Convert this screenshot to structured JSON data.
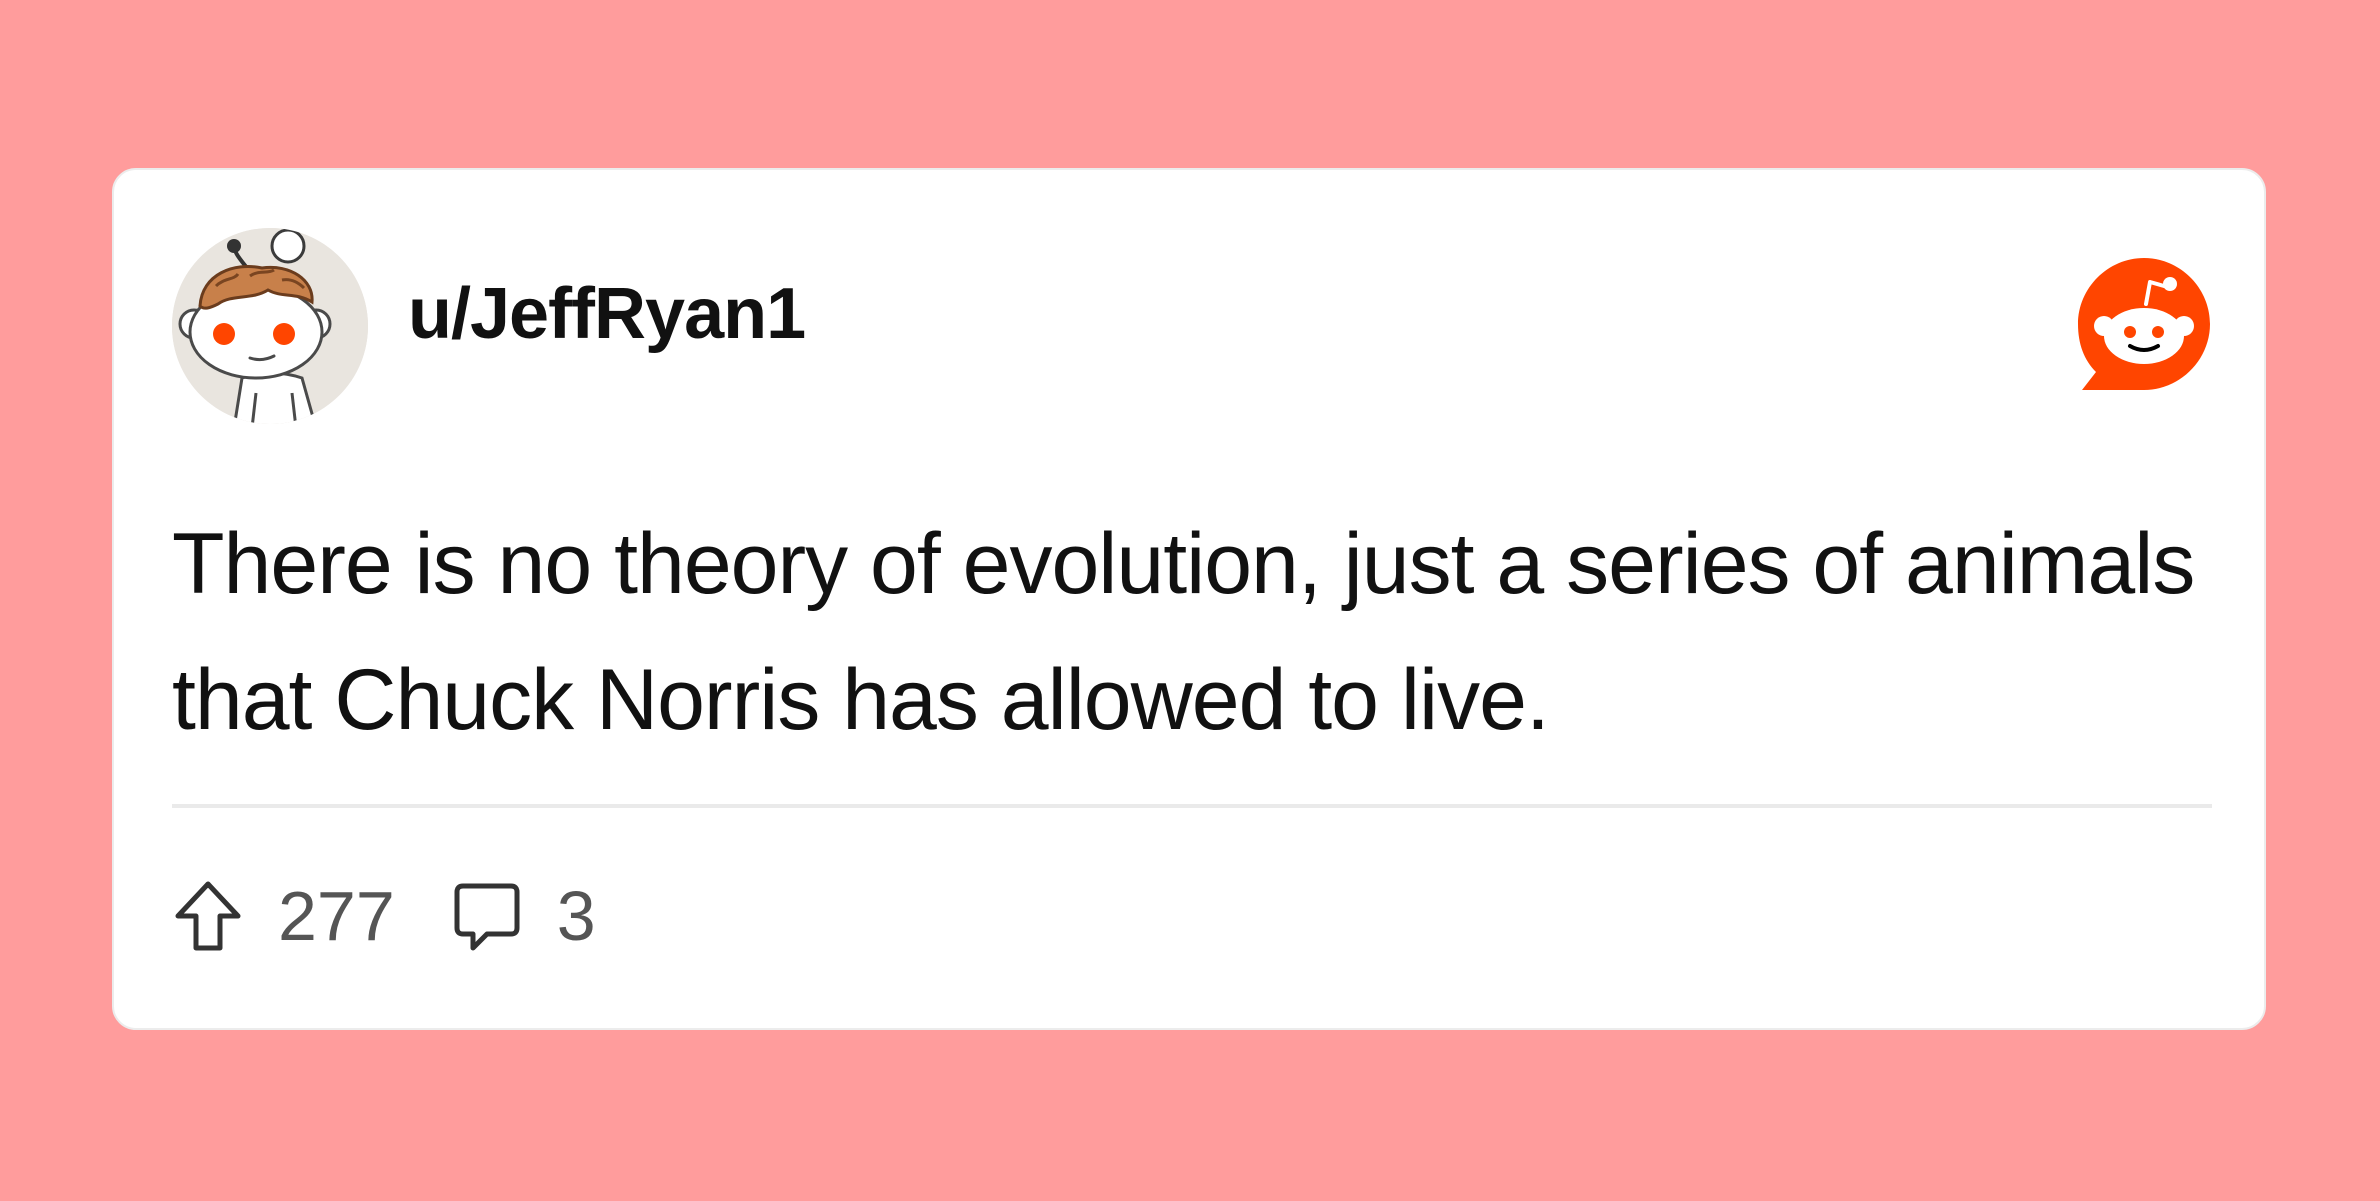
{
  "post": {
    "author": {
      "username": "u/JeffRyan1",
      "avatar_icon": "snoo-avatar-icon"
    },
    "body": "There is no theory of evolution, just a series of animals that Chuck Norris has allowed to live.",
    "stats": {
      "upvotes": "277",
      "comments": "3"
    }
  },
  "branding": {
    "logo_icon": "reddit-logo-icon"
  },
  "colors": {
    "background": "#ff9c9c",
    "card": "#ffffff",
    "accent": "#ff4500",
    "text": "#111111",
    "muted": "#555555",
    "divider": "#eaeaea"
  },
  "icons": {
    "upvote": "upvote-arrow-icon",
    "comments": "comment-bubble-icon"
  }
}
